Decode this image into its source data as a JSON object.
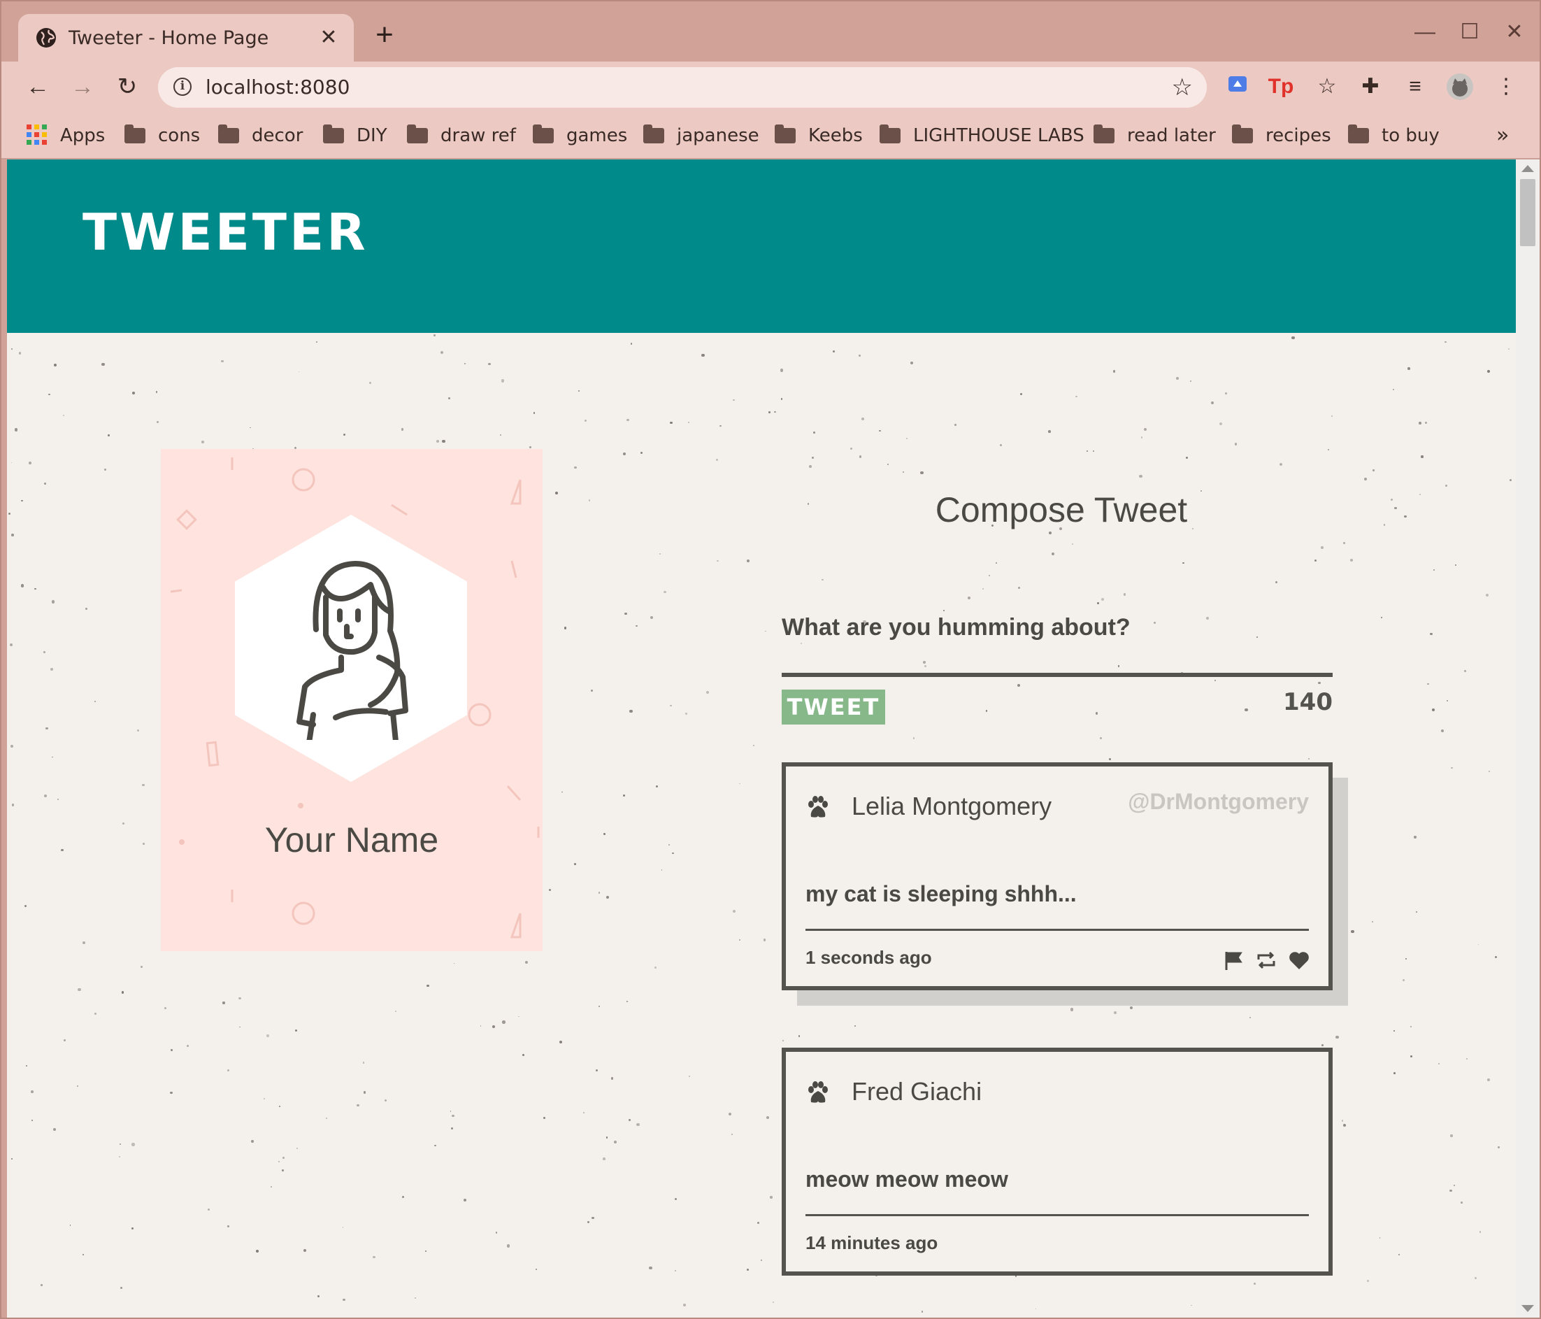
{
  "browser": {
    "tab": {
      "title": "Tweeter - Home Page"
    },
    "new_tab_label": "+",
    "address": {
      "url": "localhost:8080"
    },
    "bookmarks": [
      {
        "label": "Apps",
        "icon": "apps-grid-icon"
      },
      {
        "label": "cons",
        "icon": "folder-icon"
      },
      {
        "label": "decor",
        "icon": "folder-icon"
      },
      {
        "label": "DIY",
        "icon": "folder-icon"
      },
      {
        "label": "draw ref",
        "icon": "folder-icon"
      },
      {
        "label": "games",
        "icon": "folder-icon"
      },
      {
        "label": "japanese",
        "icon": "folder-icon"
      },
      {
        "label": "Keebs",
        "icon": "folder-icon"
      },
      {
        "label": "LIGHTHOUSE LABS",
        "icon": "folder-icon"
      },
      {
        "label": "read later",
        "icon": "folder-icon"
      },
      {
        "label": "recipes",
        "icon": "folder-icon"
      },
      {
        "label": "to buy",
        "icon": "folder-icon"
      }
    ],
    "overflow_label": "»"
  },
  "page": {
    "header": {
      "brand": "TWEETER"
    },
    "profile": {
      "name": "Your Name"
    },
    "compose": {
      "title": "Compose Tweet",
      "prompt": "What are you humming about?",
      "button_label": "TWEET",
      "counter": "140"
    },
    "tweets": [
      {
        "author": "Lelia Montgomery",
        "handle": "@DrMontgomery",
        "content": "my cat is sleeping shhh...",
        "time": "1 seconds ago"
      },
      {
        "author": "Fred Giachi",
        "handle": "",
        "content": "meow meow meow",
        "time": "14 minutes ago"
      }
    ]
  },
  "colors": {
    "header_bg": "#008a89",
    "profile_bg": "#fee3de",
    "page_bg": "#f4f1ed",
    "tweet_button": "#86b88a",
    "text": "#4b4944"
  }
}
